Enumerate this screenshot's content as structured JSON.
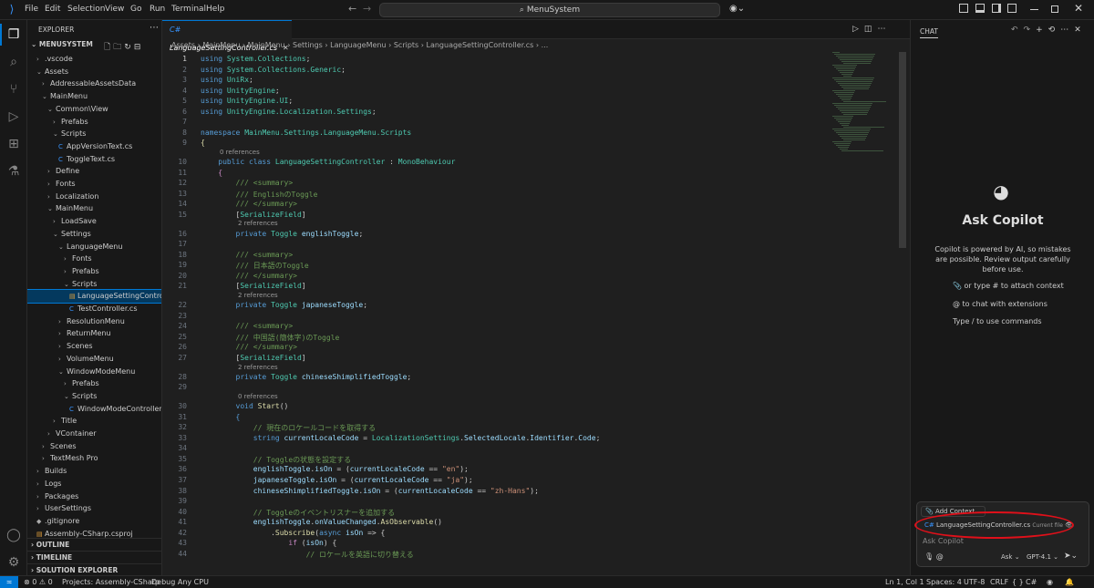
{
  "menu": [
    "File",
    "Edit",
    "Selection",
    "View",
    "Go",
    "Run",
    "Terminal",
    "Help"
  ],
  "search": "MenuSystem",
  "explorer": {
    "title": "EXPLORER",
    "root": "MENUSYSTEM",
    "items": [
      {
        "label": ".vscode",
        "chev": "›",
        "indent": 1
      },
      {
        "label": "Assets",
        "chev": "⌄",
        "indent": 1
      },
      {
        "label": "AddressableAssetsData",
        "chev": "›",
        "indent": 2
      },
      {
        "label": "MainMenu",
        "chev": "⌄",
        "indent": 2
      },
      {
        "label": "Common\\View",
        "chev": "⌄",
        "indent": 3
      },
      {
        "label": "Prefabs",
        "chev": "›",
        "indent": 4
      },
      {
        "label": "Scripts",
        "chev": "⌄",
        "indent": 4
      },
      {
        "label": "AppVersionText.cs",
        "chev": "",
        "indent": 5,
        "file": true
      },
      {
        "label": "ToggleText.cs",
        "chev": "",
        "indent": 5,
        "file": true
      },
      {
        "label": "Define",
        "chev": "›",
        "indent": 3
      },
      {
        "label": "Fonts",
        "chev": "›",
        "indent": 3
      },
      {
        "label": "Localization",
        "chev": "›",
        "indent": 3
      },
      {
        "label": "MainMenu",
        "chev": "⌄",
        "indent": 3
      },
      {
        "label": "LoadSave",
        "chev": "›",
        "indent": 4
      },
      {
        "label": "Settings",
        "chev": "⌄",
        "indent": 4
      },
      {
        "label": "LanguageMenu",
        "chev": "⌄",
        "indent": 5
      },
      {
        "label": "Fonts",
        "chev": "›",
        "indent": 6
      },
      {
        "label": "Prefabs",
        "chev": "›",
        "indent": 6
      },
      {
        "label": "Scripts",
        "chev": "⌄",
        "indent": 6
      },
      {
        "label": "LanguageSettingControll...",
        "chev": "",
        "indent": 7,
        "file": true,
        "sel": true
      },
      {
        "label": "TestController.cs",
        "chev": "",
        "indent": 7,
        "file": true
      },
      {
        "label": "ResolutionMenu",
        "chev": "›",
        "indent": 5
      },
      {
        "label": "ReturnMenu",
        "chev": "›",
        "indent": 5
      },
      {
        "label": "Scenes",
        "chev": "›",
        "indent": 5
      },
      {
        "label": "VolumeMenu",
        "chev": "›",
        "indent": 5
      },
      {
        "label": "WindowModeMenu",
        "chev": "⌄",
        "indent": 5
      },
      {
        "label": "Prefabs",
        "chev": "›",
        "indent": 6
      },
      {
        "label": "Scripts",
        "chev": "⌄",
        "indent": 6
      },
      {
        "label": "WindowModeController.cs",
        "chev": "",
        "indent": 7,
        "file": true
      },
      {
        "label": "Title",
        "chev": "›",
        "indent": 4
      },
      {
        "label": "VContainer",
        "chev": "›",
        "indent": 3
      },
      {
        "label": "Scenes",
        "chev": "›",
        "indent": 2
      },
      {
        "label": "TextMesh Pro",
        "chev": "›",
        "indent": 2
      },
      {
        "label": "Builds",
        "chev": "›",
        "indent": 1
      },
      {
        "label": "Logs",
        "chev": "›",
        "indent": 1
      },
      {
        "label": "Packages",
        "chev": "›",
        "indent": 1
      },
      {
        "label": "UserSettings",
        "chev": "›",
        "indent": 1
      },
      {
        "label": ".gitignore",
        "chev": "",
        "indent": 1,
        "file": true
      },
      {
        "label": "Assembly-CSharp.csproj",
        "chev": "",
        "indent": 1,
        "file": true
      }
    ],
    "sections": [
      "OUTLINE",
      "TIMELINE",
      "SOLUTION EXPLORER"
    ]
  },
  "tab": "LanguageSettingController.cs",
  "breadcrumb": "Assets › MainMenu › MainMenu › Settings › LanguageMenu › Scripts › LanguageSettingController.cs › ...",
  "code": [
    {
      "n": "1",
      "h": "<span class='k'>using</span> <span class='t'>System.Collections</span>;"
    },
    {
      "n": "2",
      "h": "<span class='k'>using</span> <span class='t'>System.Collections.Generic</span>;"
    },
    {
      "n": "3",
      "h": "<span class='k'>using</span> <span class='t'>UniRx</span>;"
    },
    {
      "n": "4",
      "h": "<span class='k'>using</span> <span class='t'>UnityEngine</span>;"
    },
    {
      "n": "5",
      "h": "<span class='k'>using</span> <span class='t'>UnityEngine.UI</span>;"
    },
    {
      "n": "6",
      "h": "<span class='k'>using</span> <span class='t'>UnityEngine.Localization.Settings</span>;"
    },
    {
      "n": "7",
      "h": ""
    },
    {
      "n": "8",
      "h": "<span class='k'>namespace</span> <span class='t'>MainMenu.Settings.LanguageMenu.Scripts</span>"
    },
    {
      "n": "9",
      "h": "<span class='f'>{</span>"
    },
    {
      "ref": "0 references",
      "ind": 20
    },
    {
      "n": "10",
      "h": "    <span class='k'>public class</span> <span class='t'>LanguageSettingController</span> : <span class='t'>MonoBehaviour</span>"
    },
    {
      "n": "11",
      "h": "    <span class='p'>{</span>"
    },
    {
      "n": "12",
      "h": "        <span class='c'>/// &lt;summary&gt;</span>"
    },
    {
      "n": "13",
      "h": "        <span class='c'>/// EnglishのToggle</span>"
    },
    {
      "n": "14",
      "h": "        <span class='c'>/// &lt;/summary&gt;</span>"
    },
    {
      "n": "15",
      "h": "        [<span class='t'>SerializeField</span>]"
    },
    {
      "ref": "2 references",
      "ind": 39
    },
    {
      "n": "16",
      "h": "        <span class='k'>private</span> <span class='t'>Toggle</span> <span class='v'>englishToggle</span>;"
    },
    {
      "n": "17",
      "h": ""
    },
    {
      "n": "18",
      "h": "        <span class='c'>/// &lt;summary&gt;</span>"
    },
    {
      "n": "19",
      "h": "        <span class='c'>/// 日本語のToggle</span>"
    },
    {
      "n": "20",
      "h": "        <span class='c'>/// &lt;/summary&gt;</span>"
    },
    {
      "n": "21",
      "h": "        [<span class='t'>SerializeField</span>]"
    },
    {
      "ref": "2 references",
      "ind": 39
    },
    {
      "n": "22",
      "h": "        <span class='k'>private</span> <span class='t'>Toggle</span> <span class='v'>japaneseToggle</span>;"
    },
    {
      "n": "23",
      "h": ""
    },
    {
      "n": "24",
      "h": "        <span class='c'>/// &lt;summary&gt;</span>"
    },
    {
      "n": "25",
      "h": "        <span class='c'>/// 中国語(簡体字)のToggle</span>"
    },
    {
      "n": "26",
      "h": "        <span class='c'>/// &lt;/summary&gt;</span>"
    },
    {
      "n": "27",
      "h": "        [<span class='t'>SerializeField</span>]"
    },
    {
      "ref": "2 references",
      "ind": 39
    },
    {
      "n": "28",
      "h": "        <span class='k'>private</span> <span class='t'>Toggle</span> <span class='v'>chineseShimplifiedToggle</span>;"
    },
    {
      "n": "29",
      "h": ""
    },
    {
      "ref": "0 references",
      "ind": 39
    },
    {
      "n": "30",
      "h": "        <span class='k'>void</span> <span class='f'>Start</span>()"
    },
    {
      "n": "31",
      "h": "        <span class='k'>{</span>"
    },
    {
      "n": "32",
      "h": "            <span class='c'>// 現在のロケールコードを取得する</span>"
    },
    {
      "n": "33",
      "h": "            <span class='k'>string</span> <span class='v'>currentLocaleCode</span> = <span class='t'>LocalizationSettings</span>.<span class='v'>SelectedLocale</span>.<span class='v'>Identifier</span>.<span class='v'>Code</span>;"
    },
    {
      "n": "34",
      "h": ""
    },
    {
      "n": "35",
      "h": "            <span class='c'>// Toggleの状態を設定する</span>"
    },
    {
      "n": "36",
      "h": "            <span class='v'>englishToggle</span>.<span class='v'>isOn</span> = (<span class='v'>currentLocaleCode</span> == <span class='s'>\"en\"</span>);"
    },
    {
      "n": "37",
      "h": "            <span class='v'>japaneseToggle</span>.<span class='v'>isOn</span> = (<span class='v'>currentLocaleCode</span> == <span class='s'>\"ja\"</span>);"
    },
    {
      "n": "38",
      "h": "            <span class='v'>chineseShimplifiedToggle</span>.<span class='v'>isOn</span> = (<span class='v'>currentLocaleCode</span> == <span class='s'>\"zh-Hans\"</span>);"
    },
    {
      "n": "39",
      "h": ""
    },
    {
      "n": "40",
      "h": "            <span class='c'>// Toggleのイベントリスナーを追加する</span>"
    },
    {
      "n": "41",
      "h": "            <span class='v'>englishToggle</span>.<span class='v'>onValueChanged</span>.<span class='f'>AsObservable</span>()"
    },
    {
      "n": "42",
      "h": "                .<span class='f'>Subscribe</span>(<span class='k'>async</span> <span class='v'>isOn</span> =&gt; {"
    },
    {
      "n": "43",
      "h": "                    <span class='p'>if</span> (<span class='v'>isOn</span>) {"
    },
    {
      "n": "44",
      "h": "                        <span class='c'>// ロケールを英語に切り替える</span>"
    }
  ],
  "chat": {
    "header": "CHAT",
    "title": "Ask Copilot",
    "desc": "Copilot is powered by AI, so mistakes are possible. Review output carefully before use.",
    "hint1": "or type # to attach context",
    "hint2": "to chat with extensions",
    "hint3": "Type / to use commands",
    "add_context": "Add Context...",
    "file_chip": "LanguageSettingController.cs",
    "file_chip_tag": "Current file",
    "placeholder": "Ask Copilot",
    "mode": "Ask",
    "model": "GPT-4.1"
  },
  "status": {
    "errors": "0",
    "warnings": "0",
    "project": "Projects: Assembly-CSharp",
    "config": "Debug Any CPU",
    "pos": "Ln 1, Col 1",
    "spaces": "Spaces: 4",
    "enc": "UTF-8",
    "eol": "CRLF",
    "braces": "{ }",
    "lang": "C#"
  }
}
